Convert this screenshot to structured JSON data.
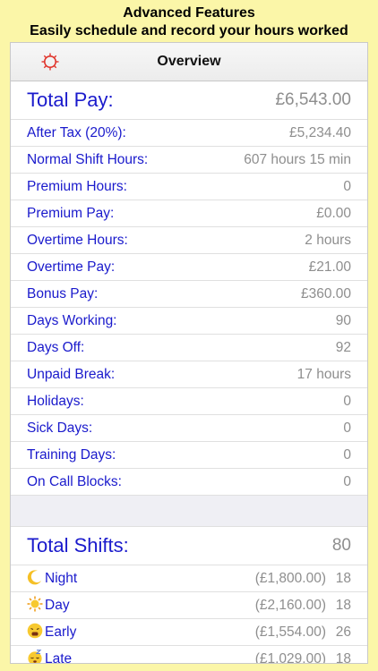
{
  "banner": {
    "line1": "Advanced Features",
    "line2": "Easily schedule and record your hours worked"
  },
  "navbar": {
    "title": "Overview",
    "icon": "gear-icon"
  },
  "summary": [
    {
      "label": "Total Pay:",
      "value": "£6,543.00"
    },
    {
      "label": "After Tax (20%):",
      "value": "£5,234.40"
    },
    {
      "label": "Normal Shift Hours:",
      "value": "607 hours 15 min"
    },
    {
      "label": "Premium Hours:",
      "value": "0"
    },
    {
      "label": "Premium Pay:",
      "value": "£0.00"
    },
    {
      "label": "Overtime Hours:",
      "value": "2 hours"
    },
    {
      "label": "Overtime Pay:",
      "value": "£21.00"
    },
    {
      "label": "Bonus Pay:",
      "value": "£360.00"
    },
    {
      "label": "Days Working:",
      "value": "90"
    },
    {
      "label": "Days Off:",
      "value": "92"
    },
    {
      "label": "Unpaid Break:",
      "value": "17 hours"
    },
    {
      "label": "Holidays:",
      "value": "0"
    },
    {
      "label": "Sick Days:",
      "value": "0"
    },
    {
      "label": "Training Days:",
      "value": "0"
    },
    {
      "label": "On Call Blocks:",
      "value": "0"
    }
  ],
  "shifts_header": {
    "label": "Total Shifts:",
    "value": "80"
  },
  "shifts": [
    {
      "icon": "crescent-moon-icon",
      "label": "Night",
      "amount": "(£1,800.00)",
      "count": "18"
    },
    {
      "icon": "sun-icon",
      "label": "Day",
      "amount": "(£2,160.00)",
      "count": "18"
    },
    {
      "icon": "tired-face-icon",
      "label": "Early",
      "amount": "(£1,554.00)",
      "count": "26"
    },
    {
      "icon": "sleeping-face-icon",
      "label": "Late",
      "amount": "(£1,029.00)",
      "count": "18"
    }
  ],
  "colors": {
    "label": "#1a1acc",
    "value": "#8e8e8e",
    "background": "#fbf6a8"
  }
}
